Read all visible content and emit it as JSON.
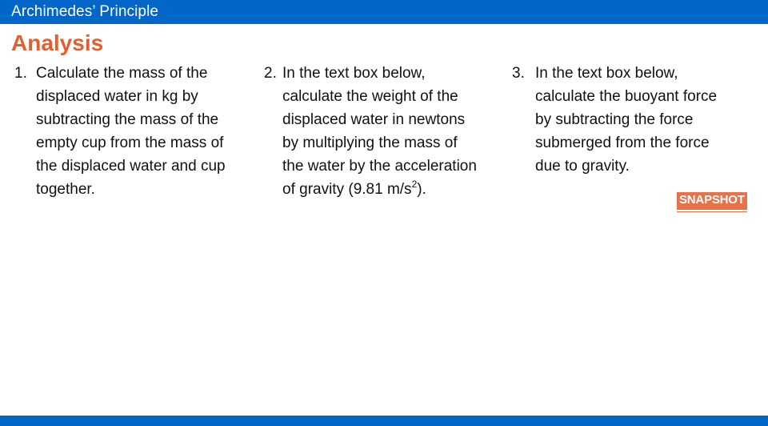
{
  "header": {
    "title": "Archimedes’ Principle",
    "color": "#0066c8"
  },
  "section": {
    "title": "Analysis",
    "color": "#e06030"
  },
  "steps": [
    {
      "number": "1.",
      "lines": [
        "Calculate the mass of the",
        "displaced water in kg by",
        "subtracting the mass of the",
        "empty cup from the mass of",
        "the displaced water and cup",
        "together."
      ]
    },
    {
      "number": "2.",
      "lines": [
        "In the text box below,",
        "calculate the weight of the",
        "displaced water in newtons",
        "by multiplying the mass of",
        "the water by the acceleration",
        "of gravity (9.81 m/s",
        "2",
        ")."
      ]
    },
    {
      "number": "3.",
      "lines": [
        "In the text box below,",
        "calculate the buoyant force",
        "by subtracting the force",
        "submerged from the force",
        "due to gravity."
      ]
    }
  ],
  "badge": {
    "label": "SNAPSHOT",
    "color": "#e8734a"
  }
}
